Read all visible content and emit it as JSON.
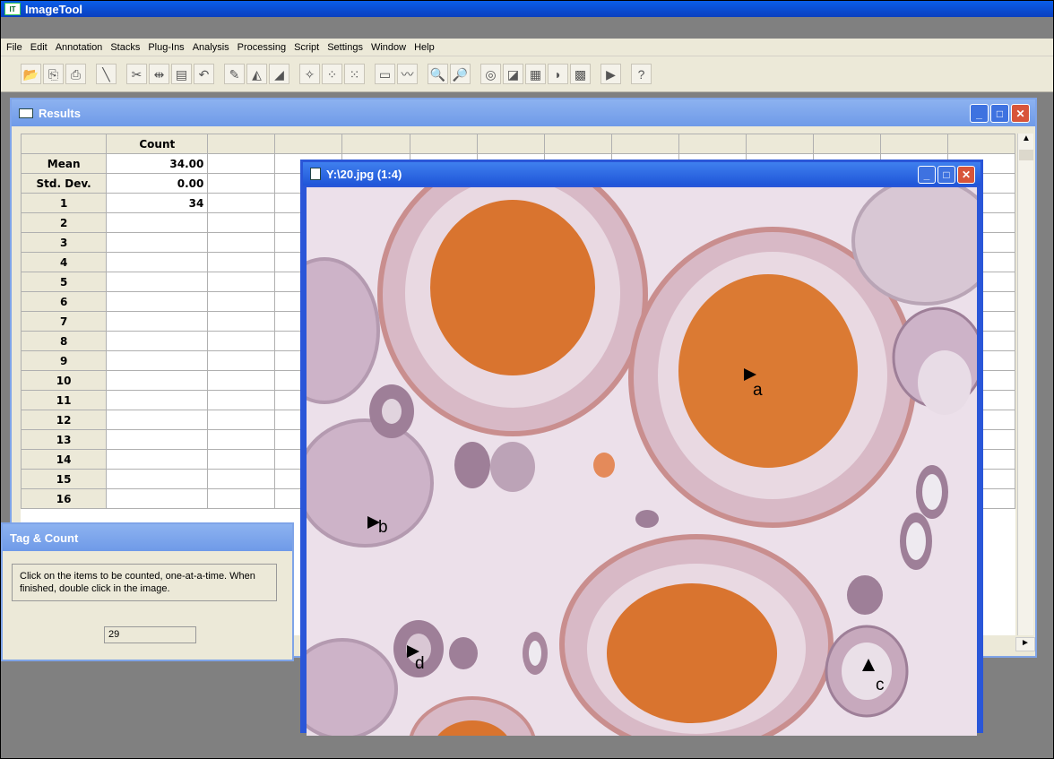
{
  "app": {
    "title": "ImageTool",
    "icon": "imagetool-app-icon"
  },
  "menu": [
    "File",
    "Edit",
    "Annotation",
    "Stacks",
    "Plug-Ins",
    "Analysis",
    "Processing",
    "Script",
    "Settings",
    "Window",
    "Help"
  ],
  "toolbar": [
    {
      "icon": "open-file-icon",
      "glyph": "📂"
    },
    {
      "icon": "copy-icon",
      "glyph": "⎘"
    },
    {
      "icon": "print-icon",
      "glyph": "⎙"
    },
    {
      "icon": "line-tool-icon",
      "glyph": "╲"
    },
    {
      "icon": "cut-icon",
      "glyph": "✂"
    },
    {
      "icon": "measure-icon",
      "glyph": "⇹"
    },
    {
      "icon": "paste-icon",
      "glyph": "▤"
    },
    {
      "icon": "undo-icon",
      "glyph": "↶"
    },
    {
      "icon": "pencil-icon",
      "glyph": "✎"
    },
    {
      "icon": "brush-icon",
      "glyph": "◭"
    },
    {
      "icon": "angle-icon",
      "glyph": "◢"
    },
    {
      "icon": "sparkle-icon",
      "glyph": "✧"
    },
    {
      "icon": "noise-icon",
      "glyph": "⁘"
    },
    {
      "icon": "scatter-icon",
      "glyph": "⁙"
    },
    {
      "icon": "histogram-icon",
      "glyph": "▭"
    },
    {
      "icon": "profile-icon",
      "glyph": "〰"
    },
    {
      "icon": "zoom-in-icon",
      "glyph": "🔍"
    },
    {
      "icon": "zoom-out-icon",
      "glyph": "🔎"
    },
    {
      "icon": "threshold-icon",
      "glyph": "◎"
    },
    {
      "icon": "gradient-icon",
      "glyph": "◪"
    },
    {
      "icon": "calculator-icon",
      "glyph": "▦"
    },
    {
      "icon": "mask-icon",
      "glyph": "◗"
    },
    {
      "icon": "filter-icon",
      "glyph": "▩"
    },
    {
      "icon": "play-icon",
      "glyph": "▶"
    },
    {
      "icon": "help-icon",
      "glyph": "?"
    }
  ],
  "results": {
    "title": "Results",
    "column_header": "Count",
    "rows": [
      {
        "label": "Mean",
        "value": "34.00"
      },
      {
        "label": "Std. Dev.",
        "value": "0.00"
      },
      {
        "label": "1",
        "value": "34"
      },
      {
        "label": "2",
        "value": ""
      },
      {
        "label": "3",
        "value": ""
      },
      {
        "label": "4",
        "value": ""
      },
      {
        "label": "5",
        "value": ""
      },
      {
        "label": "6",
        "value": ""
      },
      {
        "label": "7",
        "value": ""
      },
      {
        "label": "8",
        "value": ""
      },
      {
        "label": "9",
        "value": ""
      },
      {
        "label": "10",
        "value": ""
      },
      {
        "label": "11",
        "value": ""
      },
      {
        "label": "12",
        "value": ""
      },
      {
        "label": "13",
        "value": ""
      },
      {
        "label": "14",
        "value": ""
      },
      {
        "label": "15",
        "value": ""
      },
      {
        "label": "16",
        "value": ""
      }
    ]
  },
  "image_window": {
    "title": "Y:\\20.jpg (1:4)",
    "labels": {
      "a": "a",
      "b": "b",
      "c": "c",
      "d": "d"
    }
  },
  "tag_count": {
    "title": "Tag & Count",
    "message": "Click on the items to be counted, one-at-a-time. When finished, double click in the image.",
    "count": "29"
  },
  "window_buttons": {
    "minimize": "_",
    "maximize": "□",
    "close": "✕"
  }
}
